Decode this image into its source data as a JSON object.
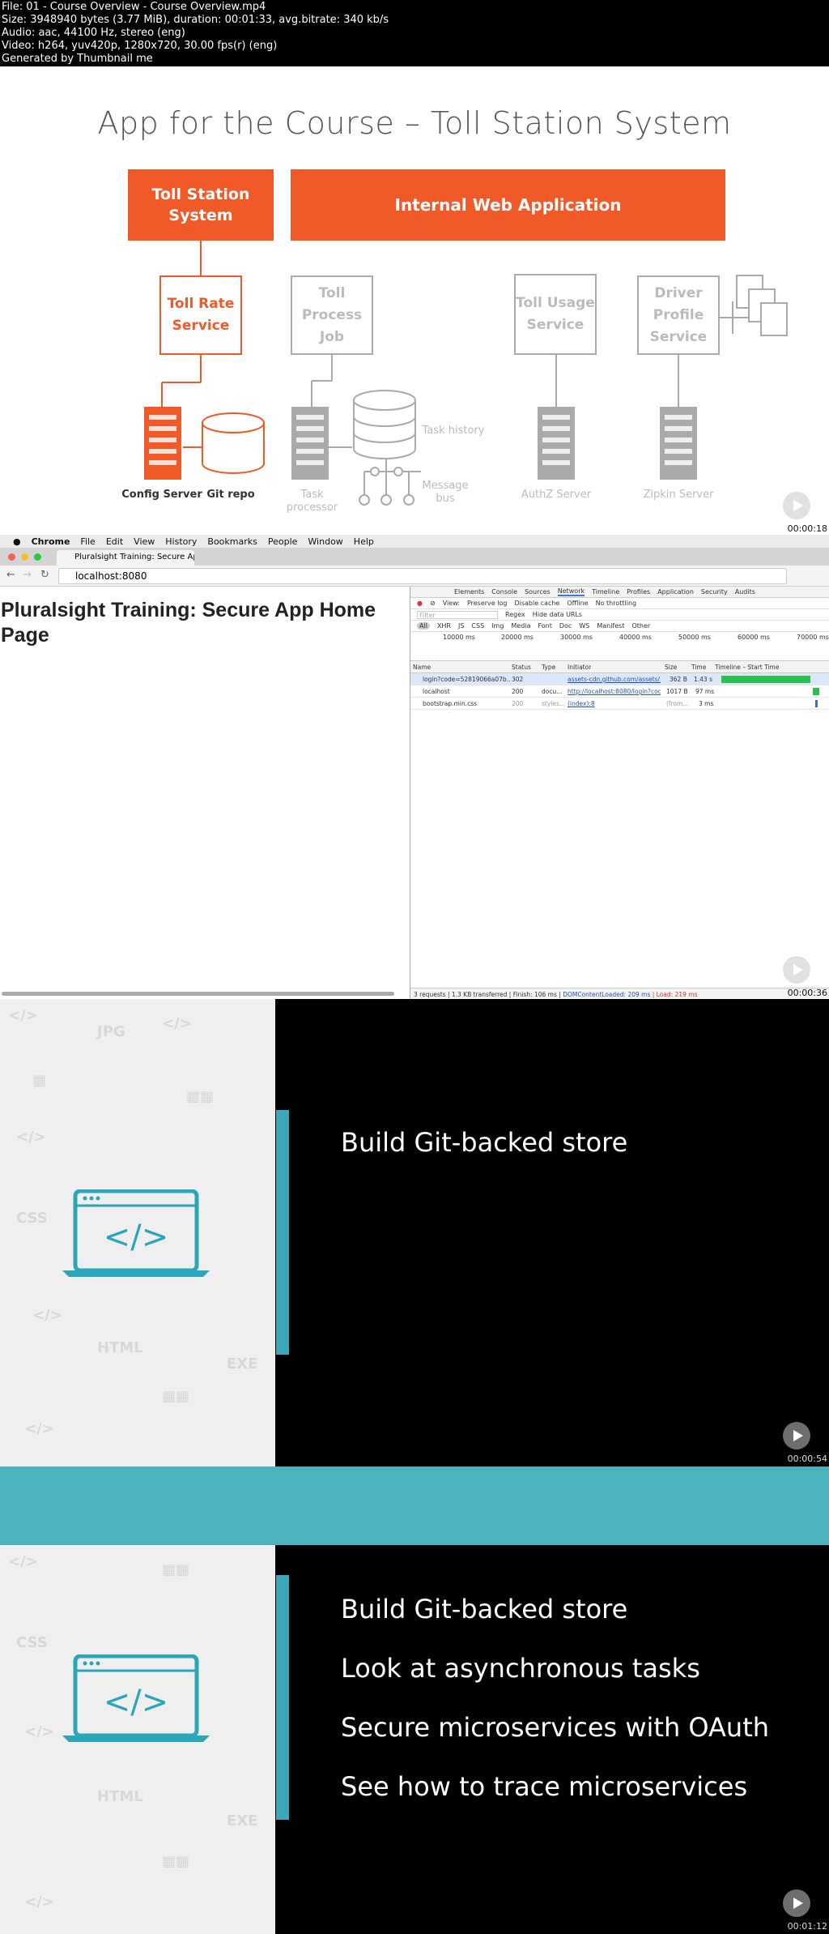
{
  "header": {
    "lines": [
      "File: 01 - Course Overview - Course Overview.mp4",
      "Size: 3948940 bytes (3.77 MiB), duration: 00:01:33, avg.bitrate: 340 kb/s",
      "Audio: aac, 44100 Hz, stereo (eng)",
      "Video: h264, yuv420p, 1280x720, 30.00 fps(r) (eng)",
      "Generated by Thumbnail me"
    ]
  },
  "frame1": {
    "timestamp": "00:00:18",
    "title": "App for the Course – Toll Station System",
    "boxes": {
      "toll_station": "Toll Station System",
      "internal_web": "Internal Web Application",
      "toll_rate": "Toll Rate Service",
      "toll_process": "Toll Process Job",
      "toll_usage": "Toll Usage Service",
      "driver_profile": "Driver Profile Service"
    },
    "captions": {
      "config_server": "Config Server",
      "git_repo": "Git repo",
      "task_processor": "Task processor",
      "task_history": "Task history",
      "message_bus": "Message bus",
      "authz_server": "AuthZ Server",
      "zipkin_server": "Zipkin Server"
    }
  },
  "frame2": {
    "timestamp": "00:00:36",
    "menubar": [
      "Chrome",
      "File",
      "Edit",
      "View",
      "History",
      "Bookmarks",
      "People",
      "Window",
      "Help"
    ],
    "tab_title": "Pluralsight Training: Secure Ap",
    "url": "localhost:8080",
    "page_heading": "Pluralsight Training: Secure App Home Page",
    "devtools": {
      "tabs": [
        "Elements",
        "Console",
        "Sources",
        "Network",
        "Timeline",
        "Profiles",
        "Application",
        "Security",
        "Audits"
      ],
      "active_tab": "Network",
      "toolbar": [
        "View:",
        "Preserve log",
        "Disable cache",
        "Offline",
        "No throttling"
      ],
      "filter_placeholder": "Filter",
      "filter_opts": [
        "Regex",
        "Hide data URLs"
      ],
      "types": [
        "All",
        "XHR",
        "JS",
        "CSS",
        "Img",
        "Media",
        "Font",
        "Doc",
        "WS",
        "Manifest",
        "Other"
      ],
      "timeline_ticks": [
        "10000 ms",
        "20000 ms",
        "30000 ms",
        "40000 ms",
        "50000 ms",
        "60000 ms",
        "70000 ms"
      ],
      "columns": [
        "Name",
        "Status",
        "Type",
        "Initiator",
        "Size",
        "Time",
        "Timeline – Start Time"
      ],
      "rows": [
        {
          "name": "login?code=52819066a07b...",
          "status": "302",
          "type": "",
          "initiator": "assets-cdn.github.com/assets/...",
          "size": "362 B",
          "time": "1.43 s"
        },
        {
          "name": "localhost",
          "status": "200",
          "type": "docu...",
          "initiator": "http://localhost:8080/login?cod...",
          "size": "1017 B",
          "time": "97 ms"
        },
        {
          "name": "bootstrap.min.css",
          "status": "200",
          "type": "styles...",
          "initiator": "(index):8",
          "size": "(from...",
          "time": "3 ms"
        }
      ],
      "status": "3 requests | 1.3 KB transferred | Finish: 106 ms |",
      "dcl": "DOMContentLoaded: 209 ms",
      "load": "Load: 219 ms"
    }
  },
  "frame3": {
    "timestamp": "00:00:54",
    "bullets": [
      "Build Git-backed store"
    ]
  },
  "frame4": {
    "timestamp": "00:01:12",
    "bullets": [
      "Build Git-backed store",
      "Look at asynchronous tasks",
      "Secure microservices with OAuth",
      "See how to trace microservices"
    ]
  },
  "colors": {
    "orange": "#f05a28",
    "teal": "#3ba7b8",
    "gray": "#aaaaaa"
  }
}
